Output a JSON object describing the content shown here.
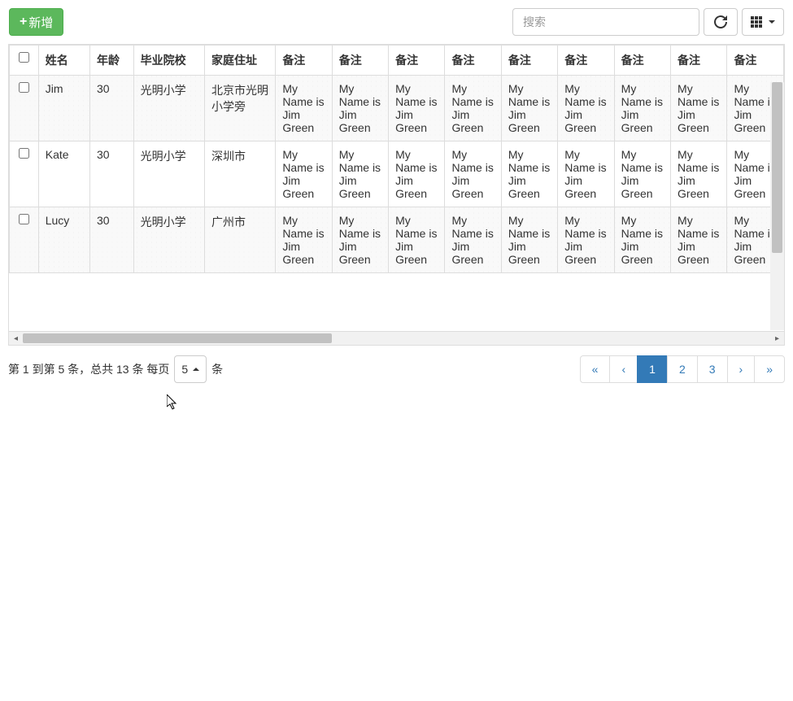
{
  "toolbar": {
    "add_label": "新增",
    "search_placeholder": "搜索"
  },
  "table": {
    "headers": [
      "姓名",
      "年龄",
      "毕业院校",
      "家庭住址",
      "备注",
      "备注",
      "备注",
      "备注",
      "备注",
      "备注",
      "备注",
      "备注",
      "备注"
    ],
    "rows": [
      {
        "name": "Jim",
        "age": "30",
        "school": "光明小学",
        "address": "北京市光明小学旁",
        "note": "My Name is Jim Green"
      },
      {
        "name": "Kate",
        "age": "30",
        "school": "光明小学",
        "address": "深圳市",
        "note": "My Name is Jim Green"
      },
      {
        "name": "Lucy",
        "age": "30",
        "school": "光明小学",
        "address": "广州市",
        "note": "My Name is Jim Green"
      }
    ]
  },
  "pagination": {
    "info_prefix": "第 1 到第 5 条，总共 13 条 每页",
    "page_size": "5",
    "info_suffix": "条",
    "first": "«",
    "prev": "‹",
    "pages": [
      "1",
      "2",
      "3"
    ],
    "active_page": "1",
    "next": "›",
    "last": "»"
  }
}
